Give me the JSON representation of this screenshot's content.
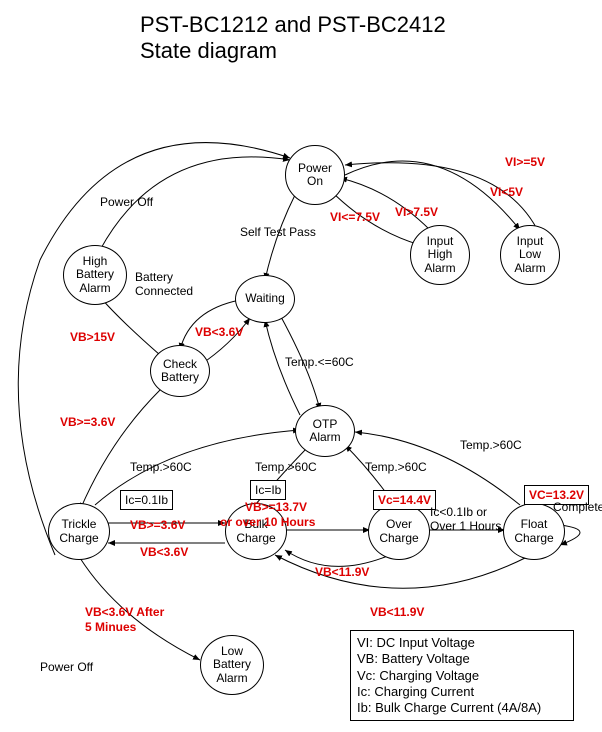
{
  "title_line1": "PST-BC1212 and PST-BC2412",
  "title_line2": "State diagram",
  "states": {
    "power_on": "Power\nOn",
    "input_high_alarm": "Input\nHigh\nAlarm",
    "input_low_alarm": "Input\nLow\nAlarm",
    "waiting": "Waiting",
    "high_battery_alarm": "High\nBattery\nAlarm",
    "check_battery": "Check\nBattery",
    "otp_alarm": "OTP\nAlarm",
    "trickle_charge": "Trickle\nCharge",
    "bulk_charge": "Bulk\nCharge",
    "over_charge": "Over\nCharge",
    "float_charge": "Float\nCharge",
    "low_battery_alarm": "Low\nBattery\nAlarm"
  },
  "edges": {
    "power_off_1": "Power Off",
    "power_off_2": "Power Off",
    "self_test_pass": "Self Test Pass",
    "vi_ge5": "VI>=5V",
    "vi_lt5": "VI<5V",
    "vi_gt75": "VI>7.5V",
    "vi_le75": "VI<=7.5V",
    "battery_connected": "Battery\nConnected",
    "vb_lt36_wait": "VB<3.6V",
    "vb_gt15": "VB>15V",
    "vb_ge36": "VB>=3.6V",
    "temp_le60": "Temp.<=60C",
    "temp_gt60_a": "Temp.>60C",
    "temp_gt60_b": "Temp.>60C",
    "temp_gt60_c": "Temp.>60C",
    "temp_gt60_d": "Temp.>60C",
    "ic_01ib": "Ic=0.1Ib",
    "ic_ib": "Ic=Ib",
    "vc_144": "Vc=14.4V",
    "vc_132": "VC=13.2V",
    "vb_ge36_2": "VB>=3.6V",
    "vb_lt36_2": "VB<3.6V",
    "vb_ge137_line1": "VB>=13.7V",
    "vb_ge137_line2": "or over 10 Hours",
    "ic_lt01ib": "Ic<0.1Ib or\nOver 1 Hours",
    "vb_lt119_a": "VB<11.9V",
    "vb_lt119_b": "VB<11.9V",
    "complete": "Complete",
    "vb_lt36_after5_line1": "VB<3.6V After",
    "vb_lt36_after5_line2": "5 Minues"
  },
  "legend": {
    "vi": "VI: DC Input Voltage",
    "vb": "VB: Battery Voltage",
    "vc": "Vc: Charging Voltage",
    "ic": "Ic: Charging Current",
    "ib": "Ib: Bulk Charge Current (4A/8A)"
  }
}
